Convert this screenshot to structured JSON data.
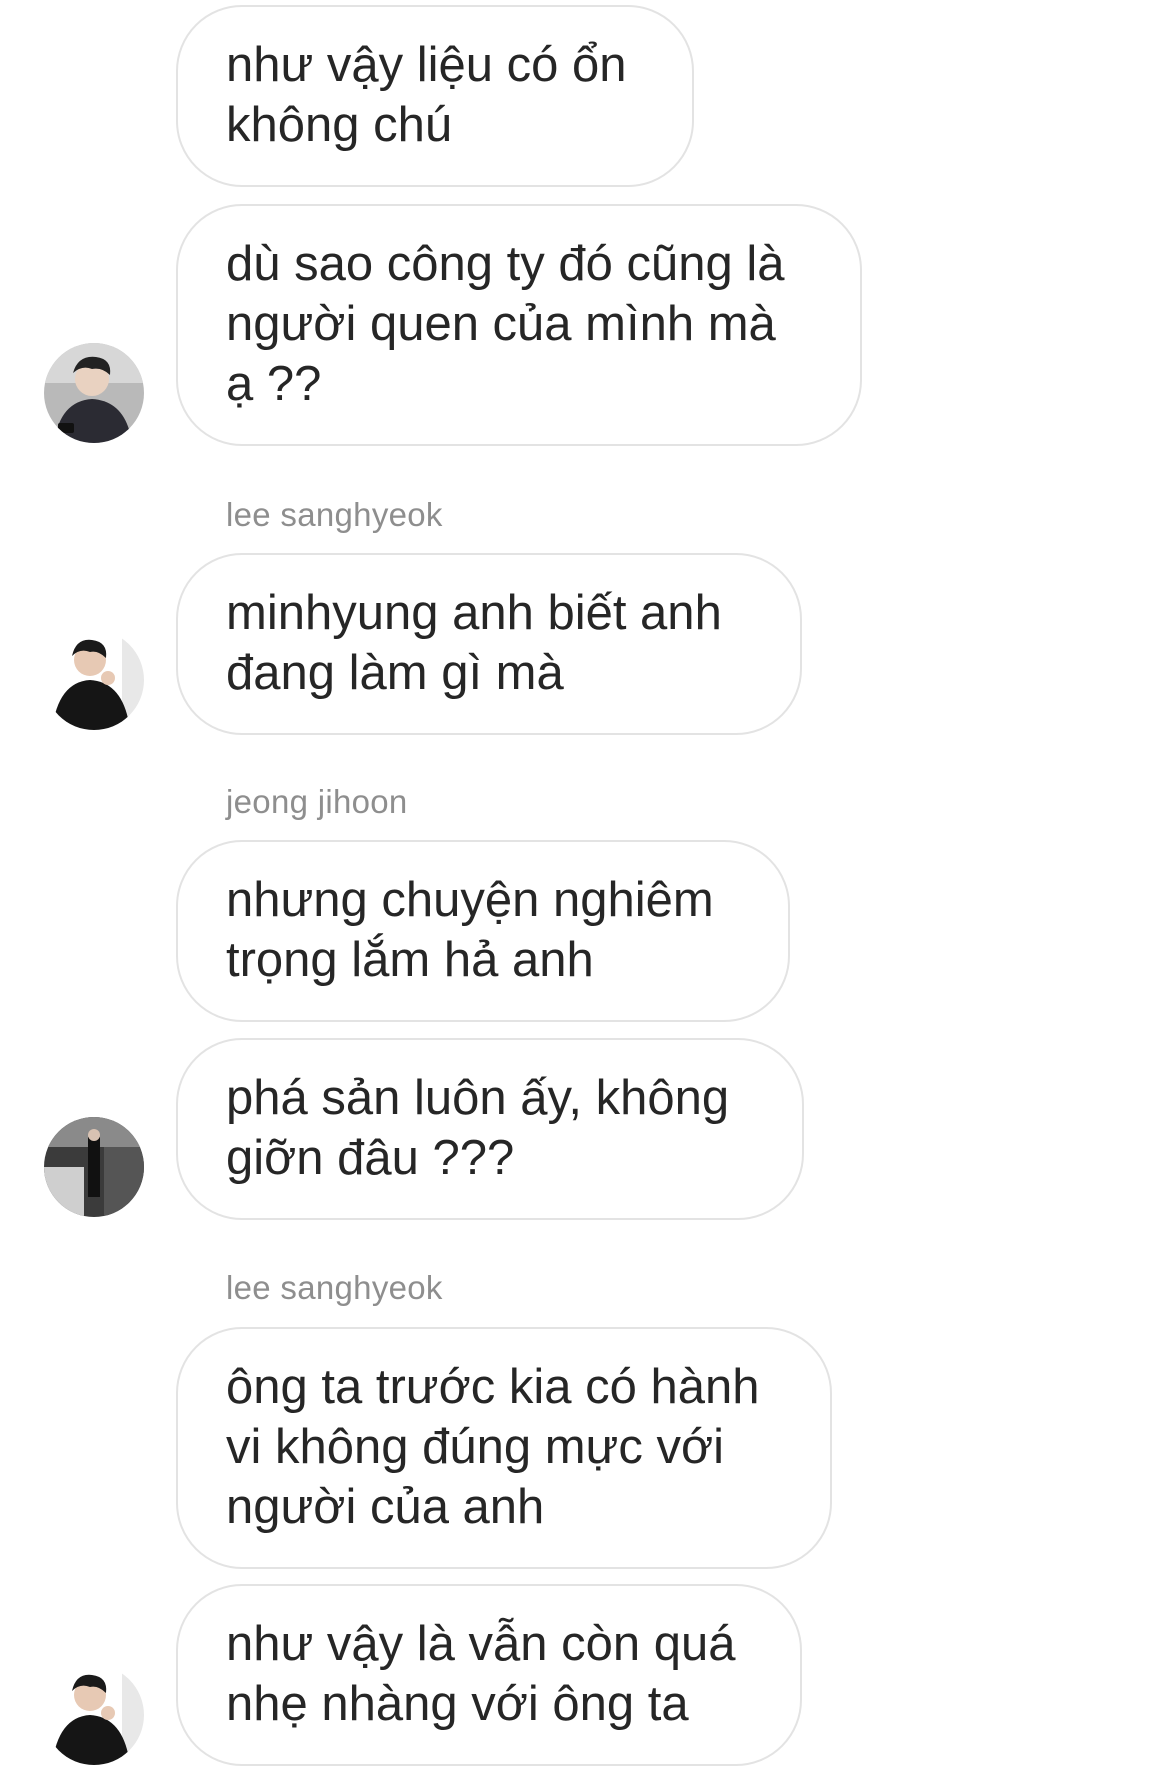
{
  "conversation": {
    "groups": [
      {
        "sender": "",
        "messages": [
          "như vậy liệu có ổn\nkhông chú",
          "dù sao công ty đó cũng là\nngười quen của mình mà\nạ ??"
        ],
        "avatar_icon": "user-avatar-icon"
      },
      {
        "sender": "lee sanghyeok",
        "messages": [
          "minhyung anh biết anh\nđang làm gì mà"
        ],
        "avatar_icon": "user-avatar-icon"
      },
      {
        "sender": "jeong jihoon",
        "messages": [
          "nhưng chuyện nghiêm\ntrọng lắm hả anh",
          "phá sản luôn ấy, không\ngiỡn đâu ???"
        ],
        "avatar_icon": "user-avatar-icon"
      },
      {
        "sender": "lee sanghyeok",
        "messages": [
          "ông ta trước kia có hành\nvi không đúng mực với\nngười của anh",
          "như vậy là vẫn còn quá\nnhẹ nhàng với ông ta"
        ],
        "avatar_icon": "user-avatar-icon"
      }
    ]
  },
  "colors": {
    "bubble_border": "#e3e3e3",
    "text": "#262626",
    "sender_text": "#8e8e8e",
    "background": "#ffffff"
  }
}
